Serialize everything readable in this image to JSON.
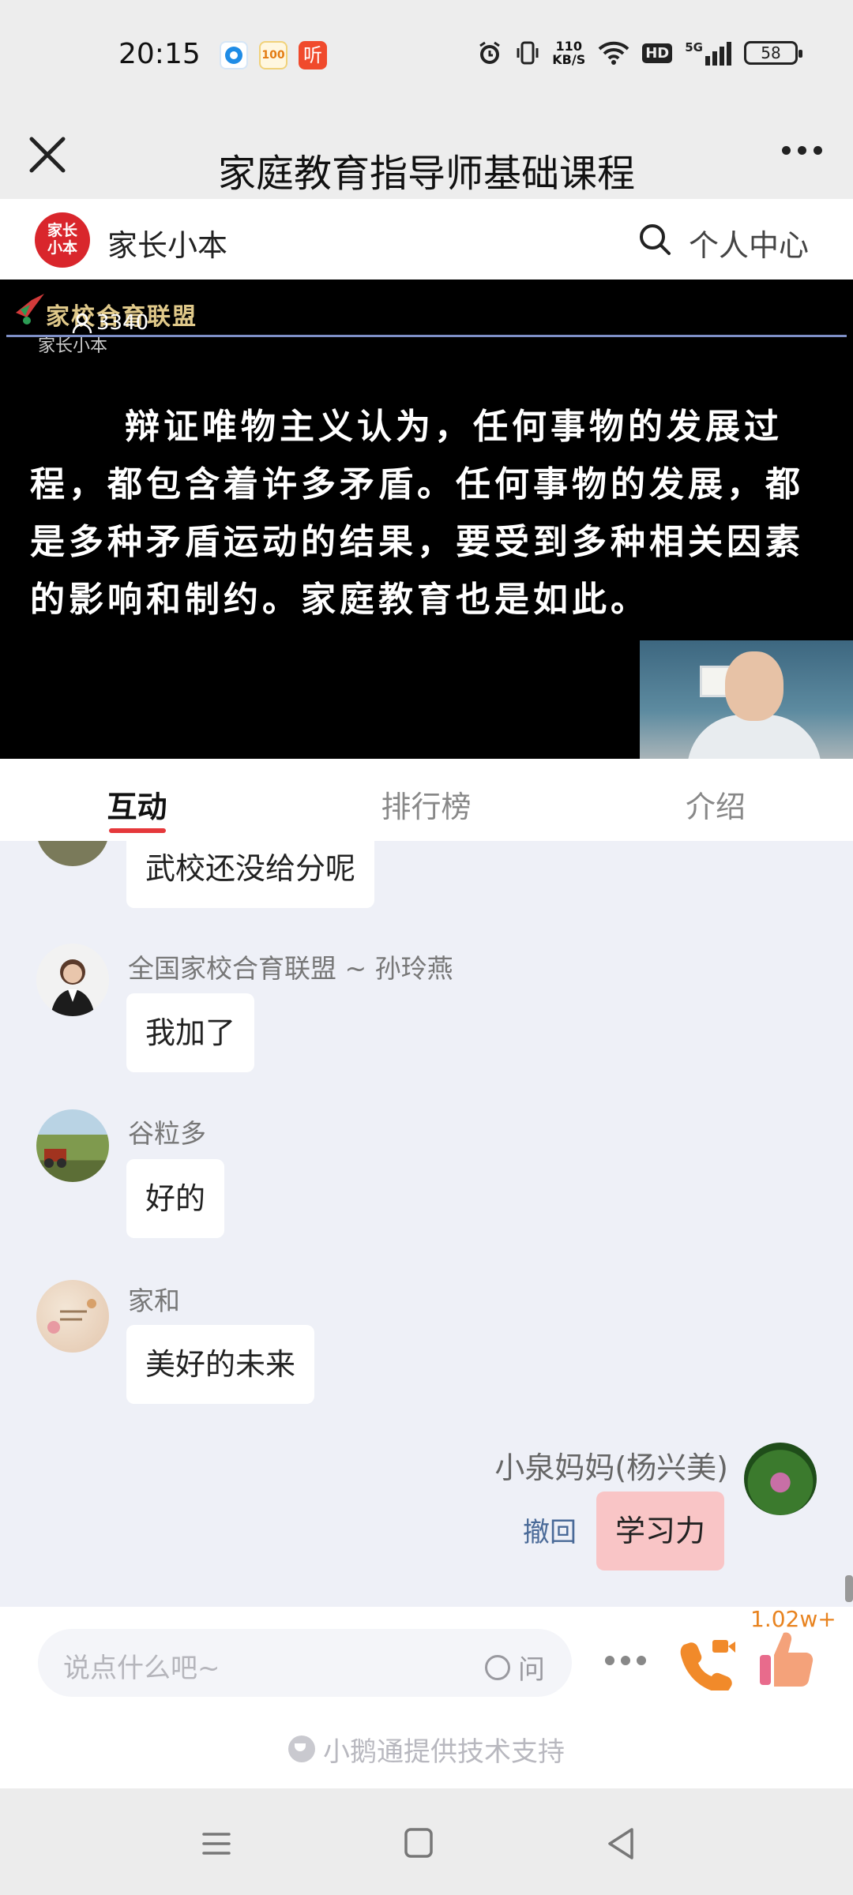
{
  "status_bar": {
    "time": "20:15",
    "net_speed_value": "110",
    "net_speed_unit": "KB/S",
    "hd_label": "HD",
    "signal_label": "5G",
    "battery": "58",
    "app_icon_2_label": "100",
    "app_icon_3_label": "听"
  },
  "nav": {
    "title": "家庭教育指导师基础课程"
  },
  "brand": {
    "logo_text": "家长小本",
    "name": "家长小本",
    "user_center": "个人中心"
  },
  "video": {
    "logo_text": "家校合育联盟",
    "sub_logo": "家长小本",
    "viewer_count": "3340",
    "slide_text": "辩证唯物主义认为，任何事物的发展过程，都包含着许多矛盾。任何事物的发展，都是多种矛盾运动的结果，要受到多种相关因素的影响和制约。家庭教育也是如此。"
  },
  "tabs": [
    {
      "label": "互动"
    },
    {
      "label": "排行榜"
    },
    {
      "label": "介绍"
    }
  ],
  "chat": {
    "messages": [
      {
        "sender": "",
        "text": "武校还没给分呢"
      },
      {
        "sender": "全国家校合育联盟 ~ 孙玲燕",
        "text": "我加了"
      },
      {
        "sender": "谷粒多",
        "text": "好的"
      },
      {
        "sender": "家和",
        "text": "美好的未来"
      },
      {
        "sender": "小泉妈妈(杨兴美)",
        "text": "学习力",
        "mine": true
      }
    ],
    "recall_label": "撤回"
  },
  "input_bar": {
    "placeholder": "说点什么吧~",
    "ask_label": "问",
    "like_count": "1.02w+"
  },
  "footer": {
    "powered_by": "小鹅通提供技术支持"
  },
  "colors": {
    "accent": "#e5383b",
    "my_bubble": "#f9c5c6",
    "like_orange": "#e8831f"
  }
}
